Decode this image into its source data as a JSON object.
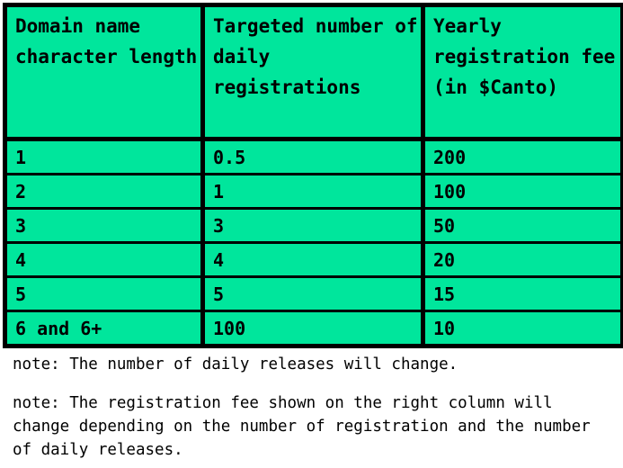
{
  "table": {
    "headers": [
      "Domain name character length",
      "Targeted number of daily registrations",
      "Yearly registration fee (in $Canto)"
    ],
    "rows": [
      {
        "length": "1",
        "daily": "0.5",
        "fee": "200"
      },
      {
        "length": "2",
        "daily": "1",
        "fee": "100"
      },
      {
        "length": "3",
        "daily": "3",
        "fee": "50"
      },
      {
        "length": "4",
        "daily": "4",
        "fee": "20"
      },
      {
        "length": "5",
        "daily": "5",
        "fee": "15"
      },
      {
        "length": "6 and 6+",
        "daily": "100",
        "fee": "10"
      }
    ]
  },
  "notes": {
    "note_1": "note: The number of daily releases will change.",
    "note_2": "note: The registration fee shown on the right column will change depending on the number of registration and the number of daily releases."
  },
  "colors": {
    "table_fill": "#00E69C",
    "border": "#000000",
    "text": "#000000",
    "background": "#FFFFFF"
  },
  "chart_data": {
    "type": "table",
    "title": "",
    "columns": [
      "Domain name character length",
      "Targeted number of daily registrations",
      "Yearly registration fee (in $Canto)"
    ],
    "rows": [
      [
        "1",
        "0.5",
        "200"
      ],
      [
        "2",
        "1",
        "100"
      ],
      [
        "3",
        "3",
        "50"
      ],
      [
        "4",
        "4",
        "20"
      ],
      [
        "5",
        "5",
        "15"
      ],
      [
        "6 and 6+",
        "100",
        "10"
      ]
    ],
    "series": [
      {
        "name": "Targeted number of daily registrations",
        "values": [
          0.5,
          1,
          3,
          4,
          5,
          100
        ]
      },
      {
        "name": "Yearly registration fee (in $Canto)",
        "values": [
          200,
          100,
          50,
          20,
          15,
          10
        ]
      }
    ],
    "categories": [
      "1",
      "2",
      "3",
      "4",
      "5",
      "6 and 6+"
    ],
    "xlabel": "Domain name character length",
    "ylabel": "",
    "annotations": [
      "note: The number of daily releases will change.",
      "note: The registration fee shown on the right column will change depending on the number of registration and the number of daily releases."
    ]
  }
}
